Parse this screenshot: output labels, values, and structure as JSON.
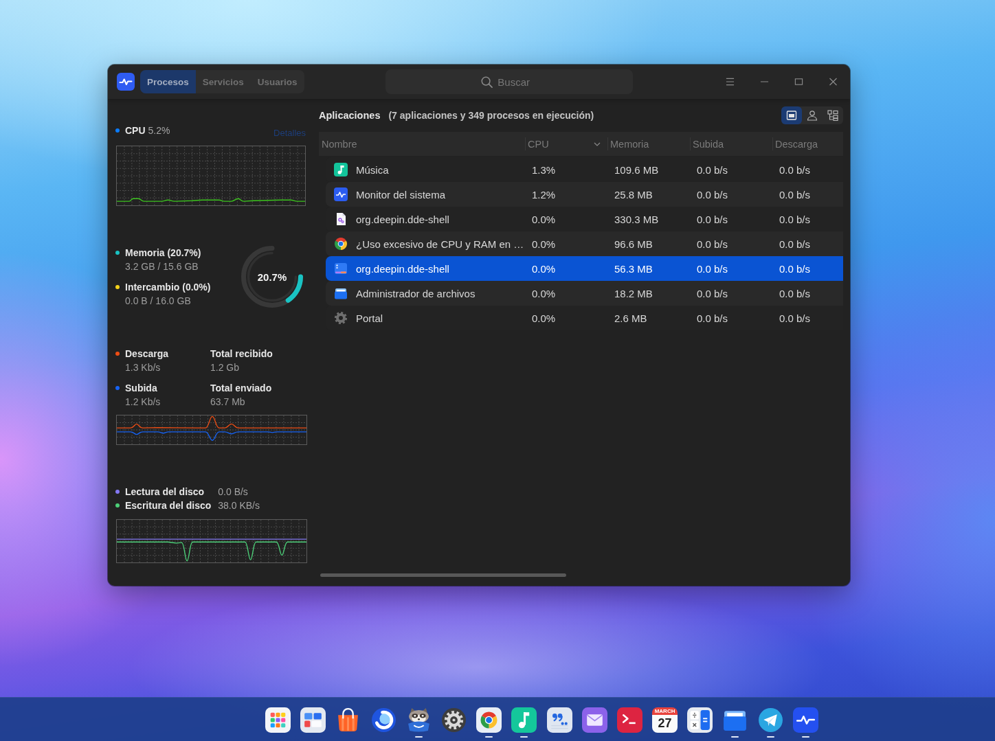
{
  "titlebar": {
    "tabs": [
      {
        "label": "Procesos",
        "selected": true
      },
      {
        "label": "Servicios",
        "selected": false
      },
      {
        "label": "Usuarios",
        "selected": false
      }
    ],
    "search": {
      "placeholder": "Buscar"
    }
  },
  "sidebar": {
    "cpu": {
      "label": "CPU",
      "value": "5.2%",
      "details_link": "Detalles"
    },
    "memory": {
      "items": [
        {
          "label": "Memoria (20.7%)",
          "detail": "3.2 GB / 15.6 GB",
          "color": "#19c3c3"
        },
        {
          "label": "Intercambio (0.0%)",
          "detail": "0.0 B / 16.0 GB",
          "color": "#f4d21a"
        }
      ],
      "ring": {
        "value": "20.7%",
        "level": 0.207
      }
    },
    "network": {
      "items": [
        {
          "label": "Descarga",
          "value": "1.3 Kb/s",
          "total_label": "Total recibido",
          "total_value": "1.2 Gb",
          "color": "#ee4d14"
        },
        {
          "label": "Subida",
          "value": "1.2 Kb/s",
          "total_label": "Total enviado",
          "total_value": "63.7 Mb",
          "color": "#1663f5"
        }
      ]
    },
    "disk": {
      "items": [
        {
          "label": "Lectura del disco",
          "value": "0.0 B/s",
          "color": "#8378f2"
        },
        {
          "label": "Escritura del disco",
          "value": "38.0 KB/s",
          "color": "#4ccf78"
        }
      ]
    }
  },
  "processes": {
    "title": "Aplicaciones",
    "summary": "(7 aplicaciones y 349 procesos en ejecución)",
    "view_buttons": [
      {
        "kind": "apps",
        "selected": true
      },
      {
        "kind": "user",
        "selected": false
      },
      {
        "kind": "tree",
        "selected": false
      }
    ],
    "columns": [
      {
        "label": "Nombre",
        "sorted": false
      },
      {
        "label": "CPU",
        "sorted": true
      },
      {
        "label": "Memoria",
        "sorted": false
      },
      {
        "label": "Subida",
        "sorted": false
      },
      {
        "label": "Descarga",
        "sorted": false
      }
    ],
    "rows": [
      {
        "kind": "music",
        "name": "Música",
        "cpu": "1.3%",
        "memory": "109.6 MB",
        "upload": "0.0 b/s",
        "download": "0.0 b/s",
        "selected": false
      },
      {
        "kind": "monitor",
        "name": "Monitor del sistema",
        "cpu": "1.2%",
        "memory": "25.8 MB",
        "upload": "0.0 b/s",
        "download": "0.0 b/s",
        "selected": false
      },
      {
        "kind": "document",
        "name": "org.deepin.dde-shell",
        "cpu": "0.0%",
        "memory": "330.3 MB",
        "upload": "0.0 b/s",
        "download": "0.0 b/s",
        "selected": false
      },
      {
        "kind": "chrome",
        "name": "¿Uso excesivo de CPU y RAM en …",
        "cpu": "0.0%",
        "memory": "96.6 MB",
        "upload": "0.0 b/s",
        "download": "0.0 b/s",
        "selected": false
      },
      {
        "kind": "window",
        "name": "org.deepin.dde-shell",
        "cpu": "0.0%",
        "memory": "56.3 MB",
        "upload": "0.0 b/s",
        "download": "0.0 b/s",
        "selected": true
      },
      {
        "kind": "files",
        "name": "Administrador de archivos",
        "cpu": "0.0%",
        "memory": "18.2 MB",
        "upload": "0.0 b/s",
        "download": "0.0 b/s",
        "selected": false
      },
      {
        "kind": "gear",
        "name": "Portal",
        "cpu": "0.0%",
        "memory": "2.6 MB",
        "upload": "0.0 b/s",
        "download": "0.0 b/s",
        "selected": false
      }
    ]
  },
  "dock": {
    "items": [
      {
        "kind": "launcher",
        "running": false
      },
      {
        "kind": "multitask",
        "running": false
      },
      {
        "kind": "store",
        "running": false
      },
      {
        "kind": "browser",
        "running": false
      },
      {
        "kind": "raccoon",
        "running": true
      },
      {
        "kind": "settings",
        "running": false
      },
      {
        "kind": "chrome",
        "running": true
      },
      {
        "kind": "music",
        "running": true
      },
      {
        "kind": "editor",
        "running": false
      },
      {
        "kind": "mail",
        "running": false
      },
      {
        "kind": "terminal",
        "running": false
      },
      {
        "kind": "calendar",
        "running": false,
        "month": "MARCH",
        "day": "27"
      },
      {
        "kind": "calculator",
        "running": false
      },
      {
        "kind": "files",
        "running": true
      },
      {
        "kind": "telegram",
        "running": true
      },
      {
        "kind": "monitor",
        "running": true
      }
    ]
  }
}
